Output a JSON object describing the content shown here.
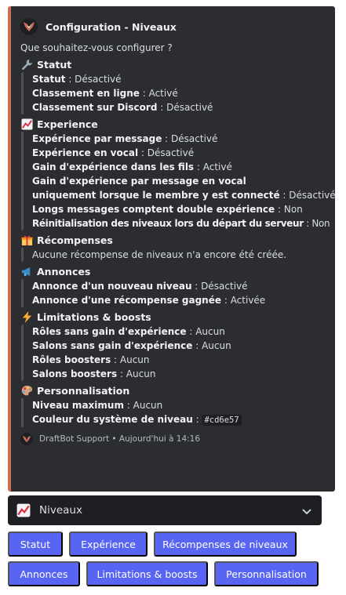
{
  "embed": {
    "accent_color": "#cd6e57",
    "author": "Configuration - Niveaux",
    "description": "Que souhaitez-vous configurer ?",
    "fields": [
      {
        "emoji": "wrench-icon",
        "title": "Statut",
        "lines": [
          {
            "label": "Statut",
            "value": " : Désactivé"
          },
          {
            "label": "Classement en ligne",
            "value": " : Activé"
          },
          {
            "label": "Classement sur Discord",
            "value": " : Désactivé"
          }
        ]
      },
      {
        "emoji": "chart-increasing-icon",
        "title": "Experience",
        "lines": [
          {
            "label": "Expérience par message",
            "value": " : Désactivé"
          },
          {
            "label": "Expérience en vocal",
            "value": " : Désactivé"
          },
          {
            "label": "Gain d'expérience dans les fils",
            "value": " : Activé"
          },
          {
            "label": "Gain d'expérience par message en vocal",
            "value": ""
          },
          {
            "label": "uniquement lorsque le membre y est connecté",
            "value": " : Désactivé"
          },
          {
            "label": "Longs messages comptent double expérience",
            "value": " : Non"
          },
          {
            "label": "Réinitialisation des niveaux lors du départ du serveur",
            "value": " : Non"
          }
        ]
      },
      {
        "emoji": "gift-icon",
        "title": "Récompenses",
        "lines": [
          {
            "label": "",
            "value": "Aucune récompense de niveaux n'a encore été créée."
          }
        ]
      },
      {
        "emoji": "megaphone-icon",
        "title": "Annonces",
        "lines": [
          {
            "label": "Annonce d'un nouveau niveau",
            "value": " : Désactivé"
          },
          {
            "label": "Annonce d'une récompense gagnée",
            "value": " : Activée"
          }
        ]
      },
      {
        "emoji": "lightning-icon",
        "title": "Limitations & boosts",
        "lines": [
          {
            "label": "Rôles sans gain d'expérience",
            "value": " : Aucun"
          },
          {
            "label": "Salons sans gain d'expérience",
            "value": " : Aucun"
          },
          {
            "label": "Rôles boosters",
            "value": " : Aucun"
          },
          {
            "label": "Salons boosters",
            "value": " : Aucun"
          }
        ]
      },
      {
        "emoji": "palette-icon",
        "title": "Personnalisation",
        "lines": [
          {
            "label": "Niveau maximum",
            "value": " : Aucun"
          },
          {
            "label": "Couleur du système de niveau",
            "value": " : ",
            "code": "#cd6e57"
          }
        ]
      }
    ],
    "footer": "DraftBot Support • Aujourd'hui à 14:16"
  },
  "select": {
    "emoji": "chart-increasing-icon",
    "label": "Niveaux"
  },
  "buttons": {
    "row1": [
      "Statut",
      "Expérience",
      "Récompenses de niveaux"
    ],
    "row2": [
      "Annonces",
      "Limitations & boosts",
      "Personnalisation"
    ],
    "color": "#5865f2"
  }
}
